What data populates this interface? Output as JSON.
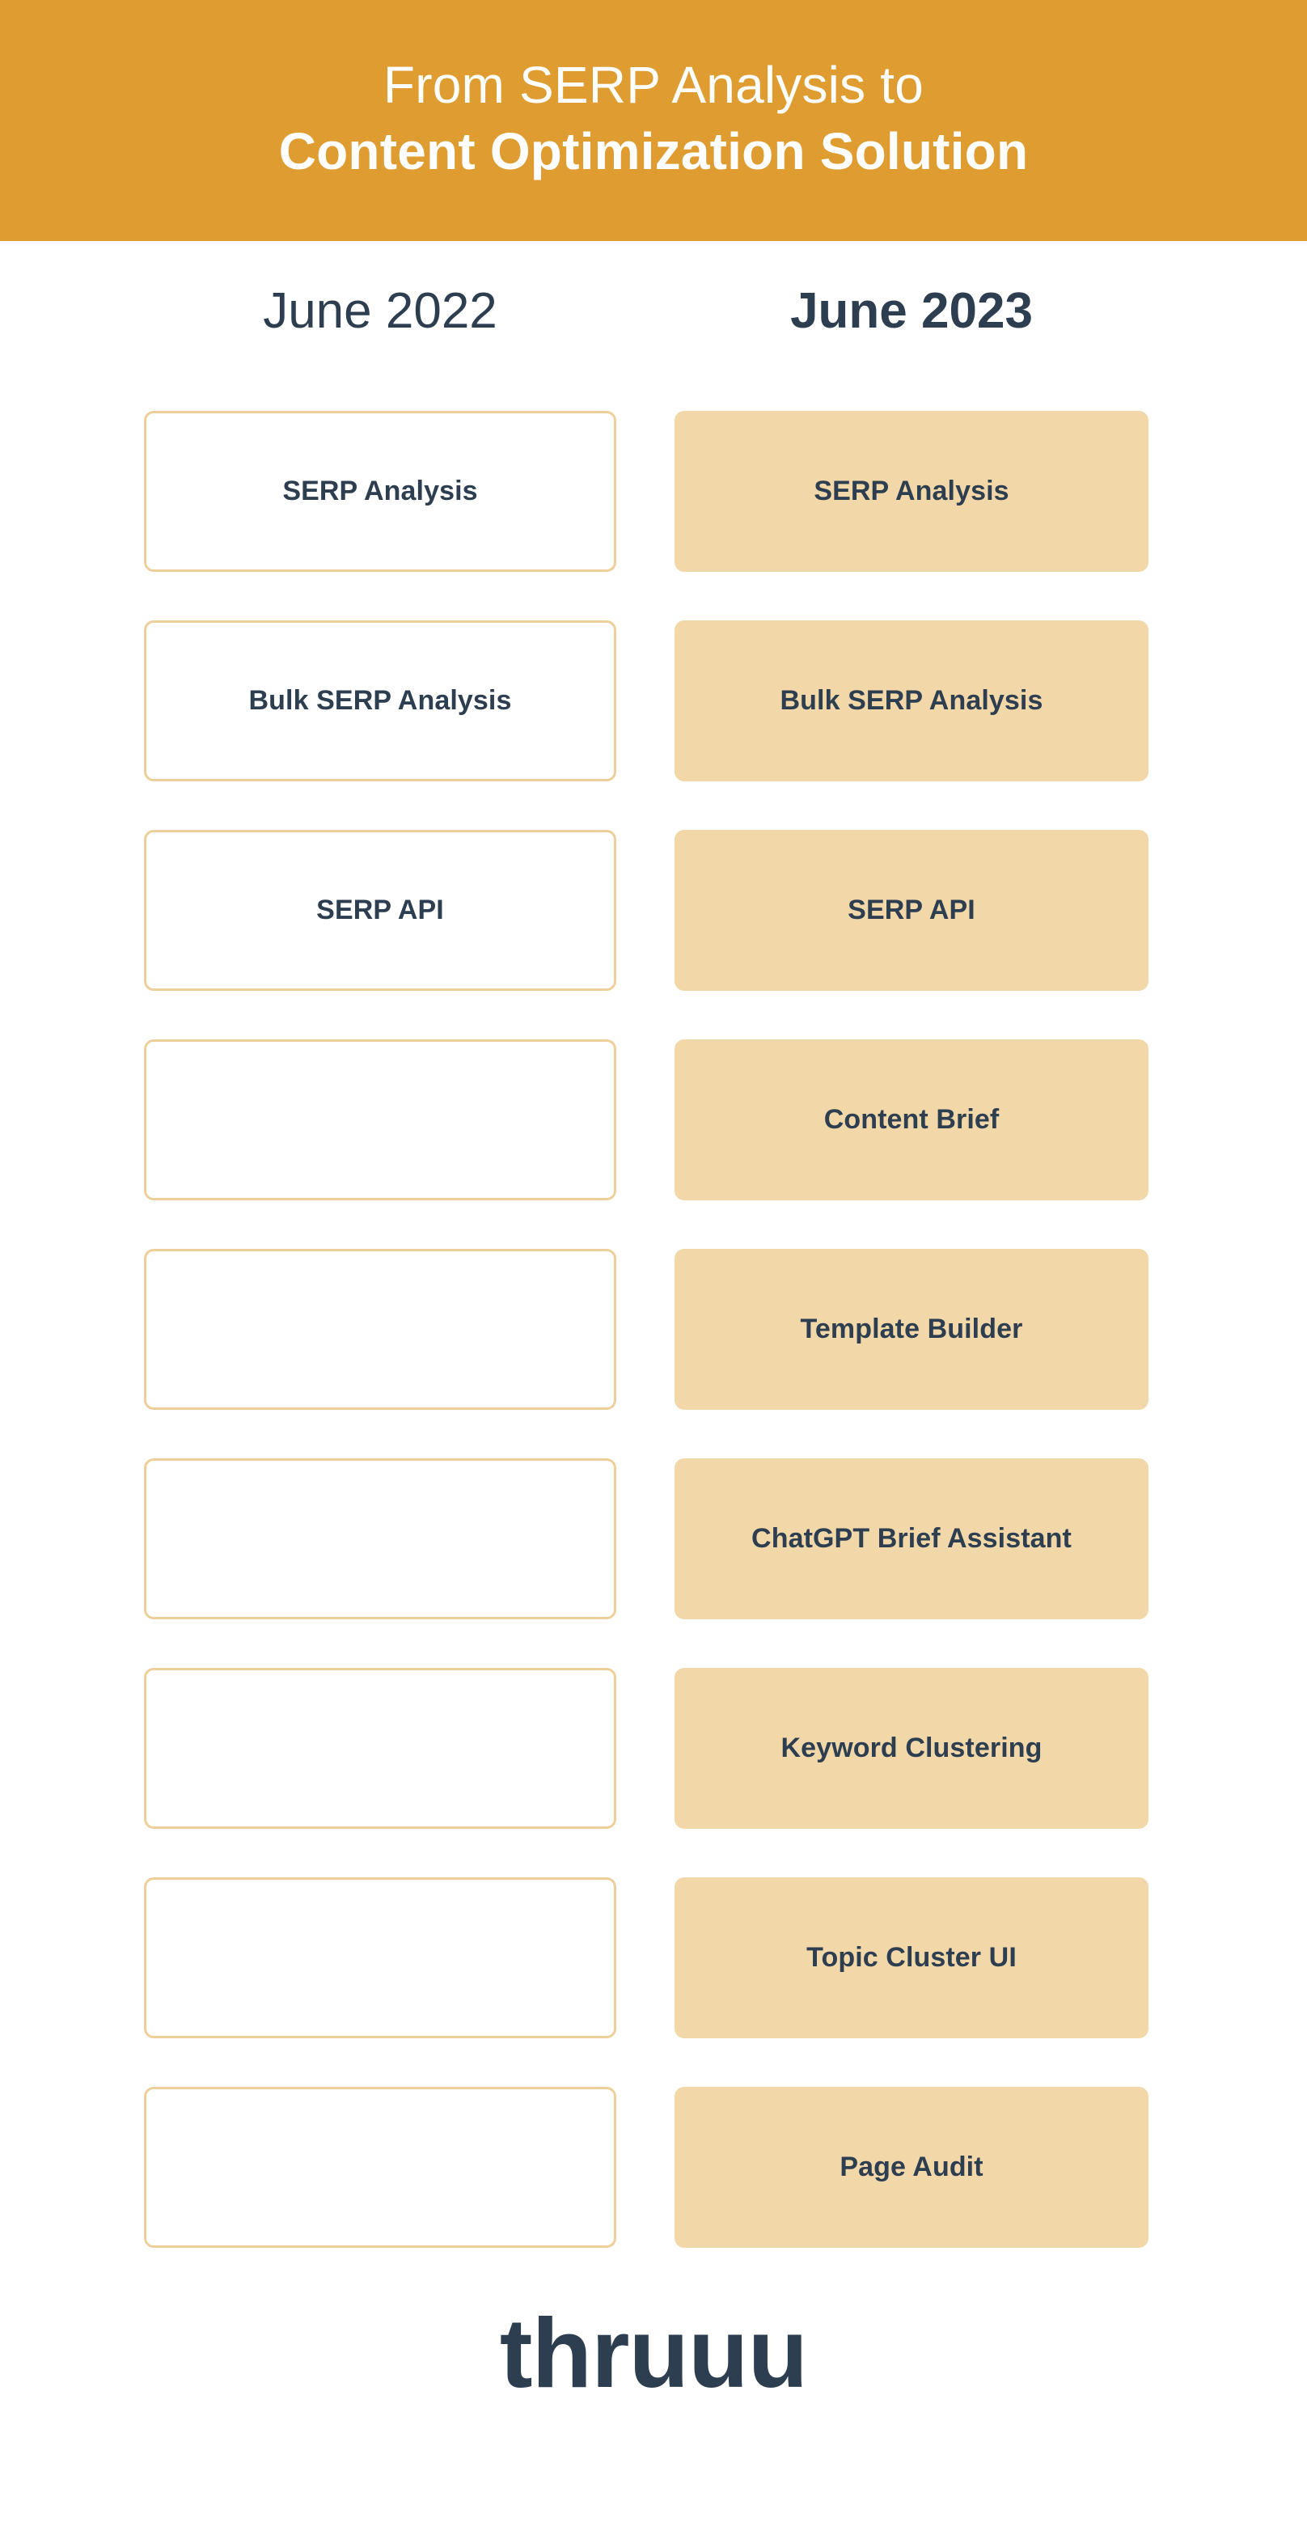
{
  "banner": {
    "line1": "From SERP Analysis to",
    "line2": "Content Optimization Solution",
    "background_color": "#df9c30",
    "text_color": "#ffffff"
  },
  "columns": {
    "past_heading": "June 2022",
    "present_heading": "June 2023"
  },
  "theme": {
    "accent_orange": "#df9c30",
    "tan_fill": "#f2d7a8",
    "tan_border": "#eecf99",
    "navy_text": "#2c3e50",
    "page_background": "#ffffff"
  },
  "rows": [
    {
      "past": "SERP Analysis",
      "present": "SERP Analysis"
    },
    {
      "past": "Bulk SERP Analysis",
      "present": "Bulk SERP Analysis"
    },
    {
      "past": "SERP API",
      "present": "SERP API"
    },
    {
      "past": "",
      "present": "Content Brief"
    },
    {
      "past": "",
      "present": "Template Builder"
    },
    {
      "past": "",
      "present": "ChatGPT Brief Assistant"
    },
    {
      "past": "",
      "present": "Keyword Clustering"
    },
    {
      "past": "",
      "present": "Topic Cluster UI"
    },
    {
      "past": "",
      "present": "Page Audit"
    }
  ],
  "brand": {
    "name": "thruuu"
  }
}
